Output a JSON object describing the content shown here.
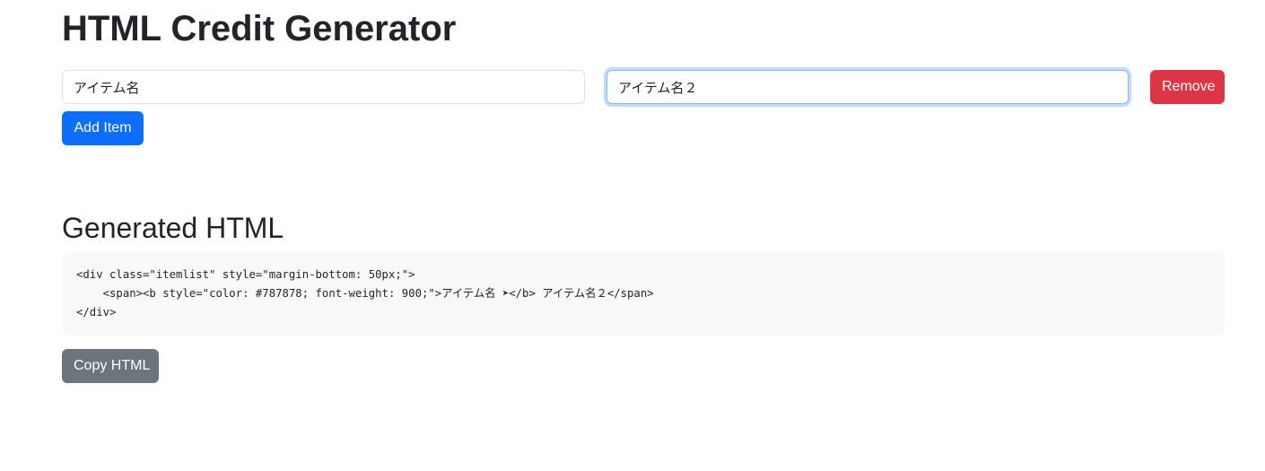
{
  "page": {
    "title": "HTML Credit Generator"
  },
  "items": [
    {
      "value": "アイテム名"
    },
    {
      "value": "アイテム名２"
    }
  ],
  "buttons": {
    "remove_label": "Remove",
    "add_label": "Add Item",
    "copy_label": "Copy HTML"
  },
  "output": {
    "heading": "Generated HTML",
    "code_lines": [
      "<div class=\"itemlist\" style=\"margin-bottom: 50px;\">",
      "    <span><b style=\"color: #787878; font-weight: 900;\">アイテム名 ➤</b> アイテム名２</span>",
      "</div>"
    ]
  },
  "colors": {
    "primary": "#0d6efd",
    "danger": "#dc3545",
    "secondary": "#6c757d",
    "focus_border": "#86b7fe",
    "code_background": "#f8f9fa"
  }
}
